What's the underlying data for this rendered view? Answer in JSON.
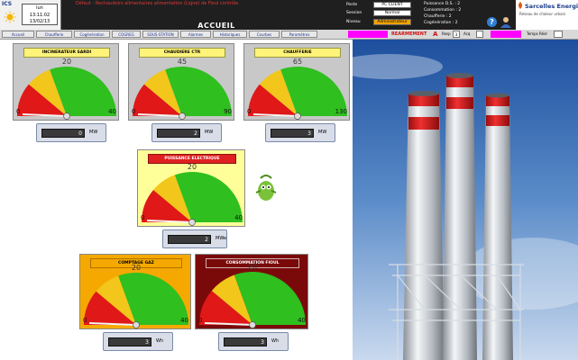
{
  "header": {
    "logo_text": "ICS",
    "clock": {
      "line1": "lun",
      "line2": "13:11:02",
      "line3": "13/02/13"
    },
    "alarm_text": "Défaut - Rechaudoirs alimentaires alimentation (Ligne) de Fioul contrôle",
    "title": "ACCUEIL",
    "user_label": "Poste",
    "user_value": "PC CLIENT",
    "login_label": "Session",
    "login_value": "Normal",
    "level_label": "Niveau",
    "level_value": "Administrateur",
    "stats": [
      "Puissance D.S. :  2",
      "Consommation :  2",
      "Chaufferie :  2",
      "Cogénération :  2"
    ],
    "help": "?",
    "brand_name": "Sarcelles Energie",
    "brand_sub": "Réseau de chaleur urbain"
  },
  "nav": {
    "buttons": [
      "Accueil",
      "Chaufferie",
      "Cogénération",
      "COGREG",
      "SOUS-STATION",
      "Alarmes",
      "Historiques",
      "Courbes",
      "Paramètres"
    ],
    "rearm_label": "REARMEMENT",
    "resp_label": "Resp",
    "resp_value": "3",
    "ack_label": "Acq",
    "temps_label": "Temps Réel"
  },
  "gauges": [
    {
      "id": "incinerateur",
      "title": "INCINERATEUR SARDI",
      "value": 20,
      "min": "0",
      "max": "40",
      "readout": "0",
      "unit": "MW",
      "style": "grey"
    },
    {
      "id": "chaudiere",
      "title": "CHAUDIERE CTR",
      "value": 45,
      "min": "0",
      "max": "90",
      "readout": "2",
      "unit": "MW",
      "style": "grey"
    },
    {
      "id": "chaufferie",
      "title": "CHAUFFERIE",
      "value": 65,
      "min": "0",
      "max": "130",
      "readout": "3",
      "unit": "MW",
      "style": "grey"
    },
    {
      "id": "puissance",
      "title": "PUISSANCE ELECTRIQUE",
      "value": 20,
      "min": "0",
      "max": "40",
      "readout": "2",
      "unit": "MWe",
      "style": "yellow"
    },
    {
      "id": "gaz",
      "title": "COMPTAGE GAZ",
      "value": 20,
      "min": "0",
      "max": "40",
      "readout": "3",
      "unit": "Wh",
      "style": "orange"
    },
    {
      "id": "fioul",
      "title": "CONSOMMATION FIOUL",
      "value": 20,
      "min": "0",
      "max": "40",
      "readout": "3",
      "unit": "Wh",
      "style": "maroon"
    }
  ],
  "colors": {
    "green": "#2fbf1f",
    "yellow": "#f2c61a",
    "red": "#e01818",
    "card_grey": "#c8c8c8",
    "card_yellow": "#ffff9a",
    "card_orange": "#f5a900",
    "card_maroon": "#7a0a0a"
  }
}
